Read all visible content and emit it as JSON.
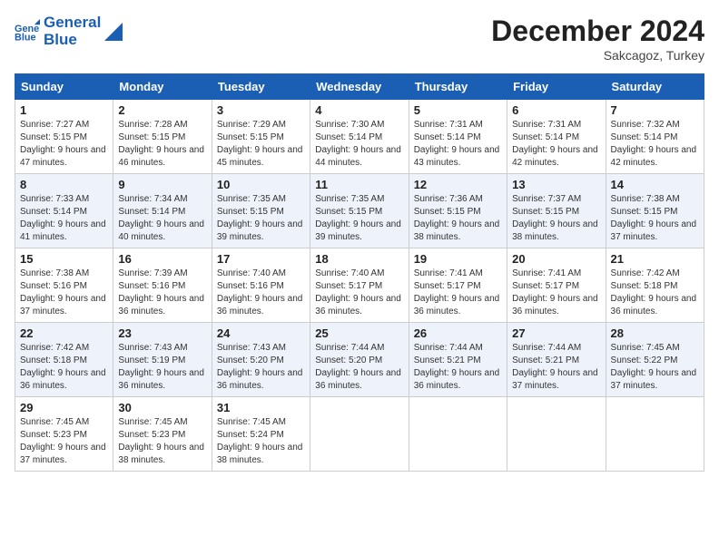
{
  "logo": {
    "line1": "General",
    "line2": "Blue"
  },
  "title": "December 2024",
  "location": "Sakcagoz, Turkey",
  "days_of_week": [
    "Sunday",
    "Monday",
    "Tuesday",
    "Wednesday",
    "Thursday",
    "Friday",
    "Saturday"
  ],
  "weeks": [
    [
      {
        "day": 1,
        "sunrise": "7:27 AM",
        "sunset": "5:15 PM",
        "daylight": "9 hours and 47 minutes."
      },
      {
        "day": 2,
        "sunrise": "7:28 AM",
        "sunset": "5:15 PM",
        "daylight": "9 hours and 46 minutes."
      },
      {
        "day": 3,
        "sunrise": "7:29 AM",
        "sunset": "5:15 PM",
        "daylight": "9 hours and 45 minutes."
      },
      {
        "day": 4,
        "sunrise": "7:30 AM",
        "sunset": "5:14 PM",
        "daylight": "9 hours and 44 minutes."
      },
      {
        "day": 5,
        "sunrise": "7:31 AM",
        "sunset": "5:14 PM",
        "daylight": "9 hours and 43 minutes."
      },
      {
        "day": 6,
        "sunrise": "7:31 AM",
        "sunset": "5:14 PM",
        "daylight": "9 hours and 42 minutes."
      },
      {
        "day": 7,
        "sunrise": "7:32 AM",
        "sunset": "5:14 PM",
        "daylight": "9 hours and 42 minutes."
      }
    ],
    [
      {
        "day": 8,
        "sunrise": "7:33 AM",
        "sunset": "5:14 PM",
        "daylight": "9 hours and 41 minutes."
      },
      {
        "day": 9,
        "sunrise": "7:34 AM",
        "sunset": "5:14 PM",
        "daylight": "9 hours and 40 minutes."
      },
      {
        "day": 10,
        "sunrise": "7:35 AM",
        "sunset": "5:15 PM",
        "daylight": "9 hours and 39 minutes."
      },
      {
        "day": 11,
        "sunrise": "7:35 AM",
        "sunset": "5:15 PM",
        "daylight": "9 hours and 39 minutes."
      },
      {
        "day": 12,
        "sunrise": "7:36 AM",
        "sunset": "5:15 PM",
        "daylight": "9 hours and 38 minutes."
      },
      {
        "day": 13,
        "sunrise": "7:37 AM",
        "sunset": "5:15 PM",
        "daylight": "9 hours and 38 minutes."
      },
      {
        "day": 14,
        "sunrise": "7:38 AM",
        "sunset": "5:15 PM",
        "daylight": "9 hours and 37 minutes."
      }
    ],
    [
      {
        "day": 15,
        "sunrise": "7:38 AM",
        "sunset": "5:16 PM",
        "daylight": "9 hours and 37 minutes."
      },
      {
        "day": 16,
        "sunrise": "7:39 AM",
        "sunset": "5:16 PM",
        "daylight": "9 hours and 36 minutes."
      },
      {
        "day": 17,
        "sunrise": "7:40 AM",
        "sunset": "5:16 PM",
        "daylight": "9 hours and 36 minutes."
      },
      {
        "day": 18,
        "sunrise": "7:40 AM",
        "sunset": "5:17 PM",
        "daylight": "9 hours and 36 minutes."
      },
      {
        "day": 19,
        "sunrise": "7:41 AM",
        "sunset": "5:17 PM",
        "daylight": "9 hours and 36 minutes."
      },
      {
        "day": 20,
        "sunrise": "7:41 AM",
        "sunset": "5:17 PM",
        "daylight": "9 hours and 36 minutes."
      },
      {
        "day": 21,
        "sunrise": "7:42 AM",
        "sunset": "5:18 PM",
        "daylight": "9 hours and 36 minutes."
      }
    ],
    [
      {
        "day": 22,
        "sunrise": "7:42 AM",
        "sunset": "5:18 PM",
        "daylight": "9 hours and 36 minutes."
      },
      {
        "day": 23,
        "sunrise": "7:43 AM",
        "sunset": "5:19 PM",
        "daylight": "9 hours and 36 minutes."
      },
      {
        "day": 24,
        "sunrise": "7:43 AM",
        "sunset": "5:20 PM",
        "daylight": "9 hours and 36 minutes."
      },
      {
        "day": 25,
        "sunrise": "7:44 AM",
        "sunset": "5:20 PM",
        "daylight": "9 hours and 36 minutes."
      },
      {
        "day": 26,
        "sunrise": "7:44 AM",
        "sunset": "5:21 PM",
        "daylight": "9 hours and 36 minutes."
      },
      {
        "day": 27,
        "sunrise": "7:44 AM",
        "sunset": "5:21 PM",
        "daylight": "9 hours and 37 minutes."
      },
      {
        "day": 28,
        "sunrise": "7:45 AM",
        "sunset": "5:22 PM",
        "daylight": "9 hours and 37 minutes."
      }
    ],
    [
      {
        "day": 29,
        "sunrise": "7:45 AM",
        "sunset": "5:23 PM",
        "daylight": "9 hours and 37 minutes."
      },
      {
        "day": 30,
        "sunrise": "7:45 AM",
        "sunset": "5:23 PM",
        "daylight": "9 hours and 38 minutes."
      },
      {
        "day": 31,
        "sunrise": "7:45 AM",
        "sunset": "5:24 PM",
        "daylight": "9 hours and 38 minutes."
      },
      null,
      null,
      null,
      null
    ]
  ],
  "labels": {
    "sunrise": "Sunrise:",
    "sunset": "Sunset:",
    "daylight": "Daylight:"
  }
}
